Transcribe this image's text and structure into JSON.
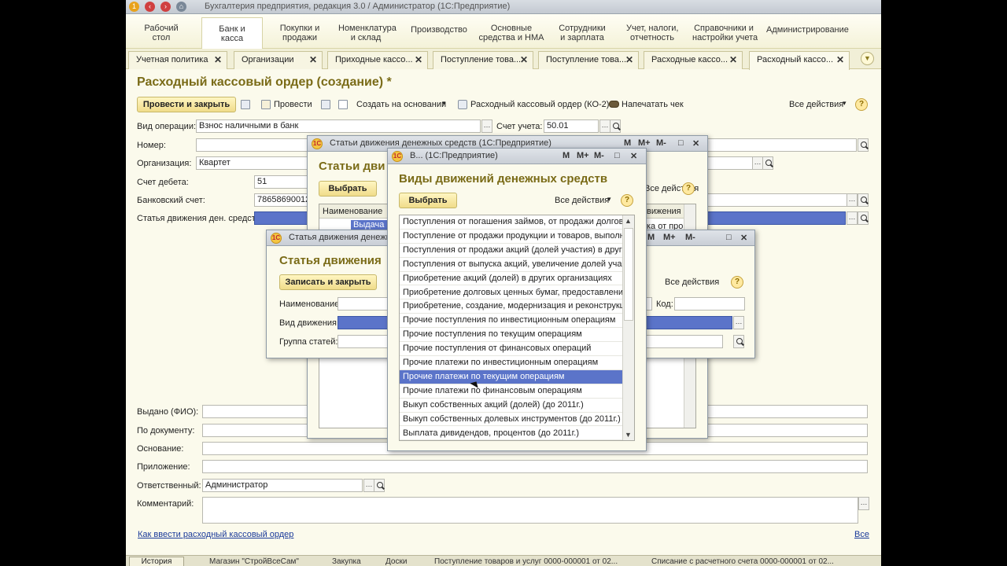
{
  "titlebar": {
    "title": "Бухгалтерия предприятия, редакция 3.0 / Администратор (1С:Предприятие)"
  },
  "sections": [
    {
      "label": "Рабочий\nстол"
    },
    {
      "label": "Банк и\nкасса"
    },
    {
      "label": "Покупки и\nпродажи"
    },
    {
      "label": "Номенклатура\nи склад"
    },
    {
      "label": "Производство"
    },
    {
      "label": "Основные\nсредства и НМА"
    },
    {
      "label": "Сотрудники\nи зарплата"
    },
    {
      "label": "Учет, налоги,\nотчетность"
    },
    {
      "label": "Справочники и\nнастройки учета"
    },
    {
      "label": "Администрирование"
    }
  ],
  "tabs": [
    {
      "label": "Учетная политика"
    },
    {
      "label": "Организации"
    },
    {
      "label": "Приходные кассо..."
    },
    {
      "label": "Поступление това..."
    },
    {
      "label": "Поступление това..."
    },
    {
      "label": "Расходные кассо..."
    },
    {
      "label": "Расходный кассо..."
    }
  ],
  "form": {
    "title": "Расходный кассовый ордер (создание) *",
    "toolbar": {
      "post_close": "Провести и закрыть",
      "post": "Провести",
      "create_based": "Создать на основании",
      "print_ko2": "Расходный кассовый ордер (КО-2)",
      "print_check": "Напечатать чек",
      "all_actions": "Все действия",
      "help": "?"
    },
    "labels": {
      "op_type": "Вид операции:",
      "number": "Номер:",
      "org": "Организация:",
      "debit_acc": "Счет дебета:",
      "bank_acc": "Банковский счет:",
      "cash_flow_item": "Статья движения ден. средств:",
      "account": "Счет учета:",
      "issued": "Выдано (ФИО):",
      "by_document": "По документу:",
      "basis": "Основание:",
      "attachment": "Приложение:",
      "responsible": "Ответственный:",
      "comment": "Комментарий:"
    },
    "values": {
      "op_type": "Взнос наличными в банк",
      "account": "50.01",
      "org": "Квартет",
      "debit_acc": "51",
      "bank_acc": "78658690012",
      "responsible": "Администратор"
    },
    "footer_link": "Как ввести расходный кассовый ордер",
    "footer_all": "Все"
  },
  "dlg_items": {
    "title": "Статьи движения денежных средств (1С:Предприятие)",
    "heading": "Статьи дви",
    "select": "Выбрать",
    "col_name": "Наименование",
    "col_flow": "вижения",
    "col_flow2": "ка от про",
    "row1": "Выдача в",
    "all_actions": "Все действия",
    "help": "?",
    "win_m": "M",
    "win_mplus": "M+",
    "win_mminus": "M-"
  },
  "dlg_item": {
    "title": "Статья движения денежных средств (1С:Предприятие)",
    "heading": "Статья движения",
    "save_close": "Записать и закрыть",
    "all_actions": "Все действия",
    "help": "?",
    "name_label": "Наименование:",
    "code_label": "Код:",
    "flow_label": "Вид движения:",
    "group_label": "Группа статей:",
    "win_m": "M",
    "win_mplus": "M+",
    "win_mminus": "M-"
  },
  "dlg_kinds": {
    "title": "В...  (1С:Предприятие)",
    "heading": "Виды движений денежных средств",
    "select": "Выбрать",
    "all_actions": "Все действия",
    "help": "?",
    "win_m": "M",
    "win_mplus": "M+",
    "win_mminus": "M-",
    "rows": [
      "Поступления от погашения займов, от продажи долгов...",
      "Поступление от продажи продукции и товаров, выполн...",
      "Поступления от продажи акций (долей участия) в други...",
      "Поступления от выпуска акций, увеличение долей учас...",
      "Приобретение акций (долей) в других организациях",
      "Приобретение долговых ценных бумаг, предоставлени...",
      "Приобретение, создание, модернизация и реконструкц...",
      "Прочие поступления по инвестиционным операциям",
      "Прочие поступления по текущим операциям",
      "Прочие поступления от финансовых операций",
      "Прочие платежи по инвестиционным операциям",
      "Прочие платежи по текущим операциям",
      "Прочие платежи по финансовым операциям",
      "Выкуп собственных акций (долей) (до 2011г.)",
      "Выкуп собственных долевых инструментов (до 2011г.)",
      "Выплата дивидендов, процентов (до 2011г.)"
    ],
    "selected_index": 11
  },
  "statusbar": {
    "history": "История",
    "items": [
      "Магазин \"СтройВсеСам\"",
      "Закупка",
      "Доски",
      "Поступление товаров и услуг 0000-000001 от 02...",
      "Списание с расчетного счета 0000-000001 от 02..."
    ]
  },
  "colors": {
    "accent": "#7a6b17",
    "selection": "#5b74c9",
    "button": "#f0dc8a"
  }
}
